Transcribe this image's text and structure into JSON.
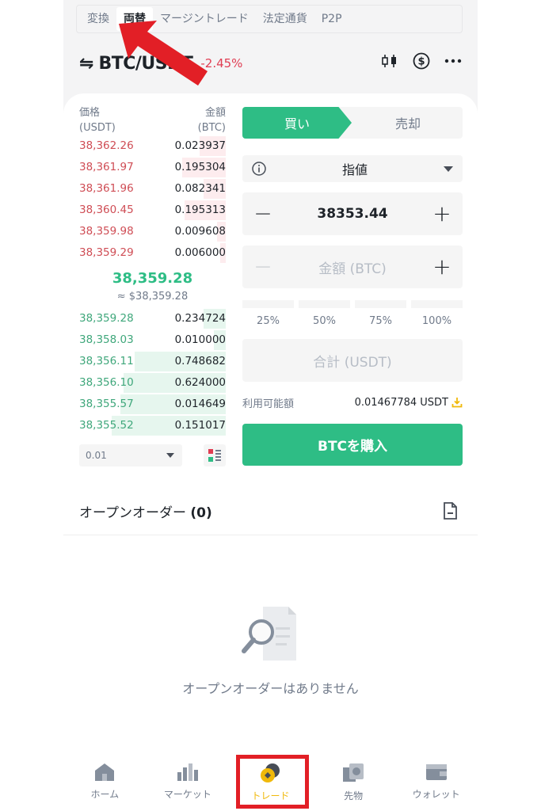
{
  "tabs": [
    {
      "label": "変換"
    },
    {
      "label": "両替"
    },
    {
      "label": "マージントレード"
    },
    {
      "label": "法定通貨"
    },
    {
      "label": "P2P"
    }
  ],
  "pair": {
    "swap_icon": "⇋",
    "name": "BTC/USDT",
    "change": "-2.45%"
  },
  "header_icons": [
    "candlestick-icon",
    "dollar-circle-icon",
    "more-icon"
  ],
  "orderbook": {
    "price_header": "価格",
    "price_unit": "(USDT)",
    "amount_header": "金額",
    "amount_unit": "(BTC)",
    "asks": [
      {
        "price": "38,362.26",
        "amount": "0.023937",
        "depth": 0.18
      },
      {
        "price": "38,361.97",
        "amount": "0.195304",
        "depth": 0.3
      },
      {
        "price": "38,361.96",
        "amount": "0.082341",
        "depth": 0.15
      },
      {
        "price": "38,360.45",
        "amount": "0.195313",
        "depth": 0.28
      },
      {
        "price": "38,359.98",
        "amount": "0.009608",
        "depth": 0.06
      },
      {
        "price": "38,359.29",
        "amount": "0.006000",
        "depth": 0.04
      }
    ],
    "mid_price": "38,359.28",
    "mid_usd": "≈ $38,359.28",
    "bids": [
      {
        "price": "38,359.28",
        "amount": "0.234724",
        "depth": 0.15
      },
      {
        "price": "38,358.03",
        "amount": "0.010000",
        "depth": 0.08
      },
      {
        "price": "38,356.11",
        "amount": "0.748682",
        "depth": 0.62
      },
      {
        "price": "38,356.10",
        "amount": "0.624000",
        "depth": 0.7
      },
      {
        "price": "38,355.57",
        "amount": "0.014649",
        "depth": 0.72
      },
      {
        "price": "38,355.52",
        "amount": "0.151017",
        "depth": 0.78
      }
    ],
    "depth_step": "0.01"
  },
  "form": {
    "buy_label": "買い",
    "sell_label": "売却",
    "order_type": "指値",
    "price_value": "38353.44",
    "amount_placeholder": "金額 (BTC)",
    "percents": [
      "25%",
      "50%",
      "75%",
      "100%"
    ],
    "total_placeholder": "合計 (USDT)",
    "available_label": "利用可能額",
    "available_value": "0.01467784 USDT",
    "buy_button": "BTCを購入"
  },
  "open_orders": {
    "title": "オープンオーダー",
    "count": "(0)",
    "empty_text": "オープンオーダーはありません"
  },
  "nav": [
    {
      "label": "ホーム",
      "icon": "home-icon"
    },
    {
      "label": "マーケット",
      "icon": "market-bars-icon"
    },
    {
      "label": "トレード",
      "icon": "trade-coins-icon",
      "active": true
    },
    {
      "label": "先物",
      "icon": "futures-icon"
    },
    {
      "label": "ウォレット",
      "icon": "wallet-icon"
    }
  ],
  "colors": {
    "accent_green": "#2ebd85",
    "ask_red": "#cf4d55",
    "brand_yellow": "#f0b90b",
    "annotation_red": "#e21f26"
  }
}
